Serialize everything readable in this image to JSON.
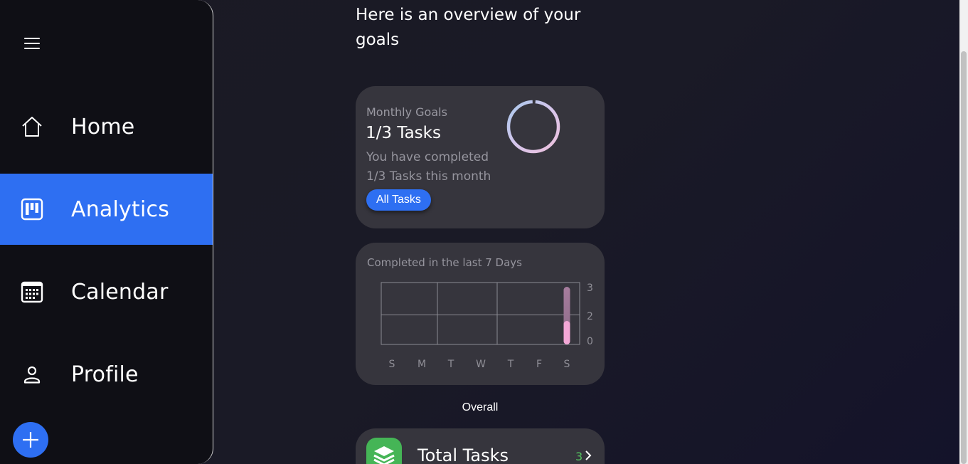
{
  "sidebar": {
    "items": [
      {
        "label": "Home",
        "icon": "home-icon"
      },
      {
        "label": "Analytics",
        "icon": "analytics-icon",
        "active": true
      },
      {
        "label": "Calendar",
        "icon": "calendar-icon"
      },
      {
        "label": "Profile",
        "icon": "profile-icon"
      }
    ]
  },
  "header": {
    "title": "Here is an overview of your goals"
  },
  "goals_card": {
    "subtitle": "Monthly Goals",
    "count": "1/3 Tasks",
    "description": "You have completed 1/3 Tasks this month",
    "button_label": "All Tasks",
    "progress_fraction": 0.333
  },
  "chart_card": {
    "title": "Completed in the last 7 Days"
  },
  "chart_data": {
    "type": "bar",
    "categories": [
      "S",
      "M",
      "T",
      "W",
      "T",
      "F",
      "S"
    ],
    "values": [
      0,
      0,
      0,
      0,
      0,
      0,
      1
    ],
    "total_bar_value": 3,
    "y_ticks": [
      "3",
      "2",
      "0"
    ],
    "ylim": [
      0,
      3
    ],
    "grid": true,
    "title": "Completed in the last 7 Days"
  },
  "overall": {
    "label": "Overall"
  },
  "total_card": {
    "label": "Total Tasks",
    "count": "3",
    "icon": "layers-icon"
  },
  "colors": {
    "accent": "#2e6ff2",
    "card_bg": "#36353d",
    "success": "#45b556"
  }
}
